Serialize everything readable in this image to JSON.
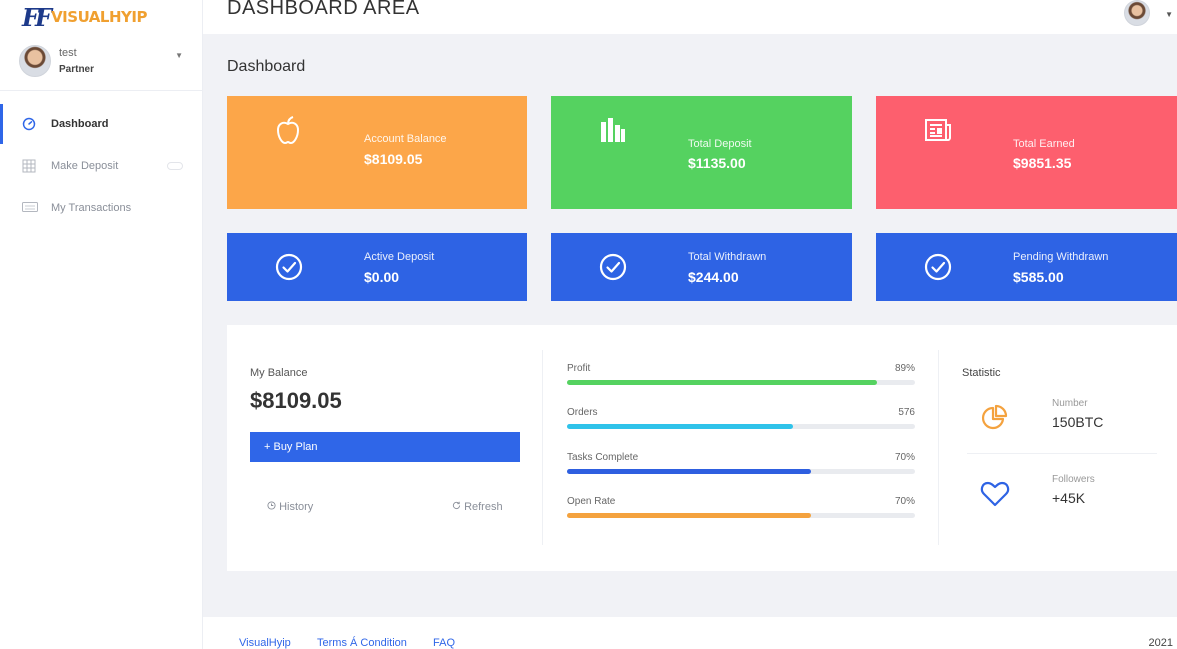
{
  "brand": {
    "mark": "FF",
    "name": "VISUALHYIP"
  },
  "user": {
    "name": "test",
    "role": "Partner"
  },
  "nav": [
    {
      "label": "Dashboard",
      "icon": "gauge-icon",
      "active": true
    },
    {
      "label": "Make Deposit",
      "icon": "grid-icon",
      "active": false
    },
    {
      "label": "My Transactions",
      "icon": "keyboard-icon",
      "active": false
    }
  ],
  "header": {
    "title": "DASHBOARD AREA"
  },
  "main": {
    "title": "Dashboard"
  },
  "cards": [
    {
      "label": "Account Balance",
      "value": "$8109.05",
      "icon": "apple-icon",
      "color": "#fca649"
    },
    {
      "label": "Total Deposit",
      "value": "$1135.00",
      "icon": "bar-chart-icon",
      "color": "#55d260"
    },
    {
      "label": "Total Earned",
      "value": "$9851.35",
      "icon": "newspaper-icon",
      "color": "#fd5f6e"
    },
    {
      "label": "Active Deposit",
      "value": "$0.00",
      "icon": "check-circle-icon",
      "color": "#2e63e4"
    },
    {
      "label": "Total Withdrawn",
      "value": "$244.00",
      "icon": "check-circle-icon",
      "color": "#2e63e4"
    },
    {
      "label": "Pending Withdrawn",
      "value": "$585.00",
      "icon": "check-circle-icon",
      "color": "#2e63e4"
    }
  ],
  "balance": {
    "title": "My Balance",
    "value": "$8109.05",
    "buy_label": "+ Buy Plan",
    "history_label": "History",
    "refresh_label": "Refresh"
  },
  "progress": [
    {
      "label": "Profit",
      "value": "89%",
      "fill": 0.89,
      "color": "#55d260"
    },
    {
      "label": "Orders",
      "value": "576",
      "fill": 0.65,
      "color": "#2fc3ea"
    },
    {
      "label": "Tasks Complete",
      "value": "70%",
      "fill": 0.7,
      "color": "#2e5fe0"
    },
    {
      "label": "Open Rate",
      "value": "70%",
      "fill": 0.7,
      "color": "#f4a23e"
    }
  ],
  "statistic": {
    "title": "Statistic",
    "items": [
      {
        "label": "Number",
        "value": "150BTC",
        "icon": "pie-chart-icon",
        "color": "#f4a23e"
      },
      {
        "label": "Followers",
        "value": "+45K",
        "icon": "heart-icon",
        "color": "#2e63e4"
      }
    ]
  },
  "footer": {
    "links": [
      "VisualHyip",
      "Terms Á Condition",
      "FAQ"
    ],
    "year": "2021"
  }
}
